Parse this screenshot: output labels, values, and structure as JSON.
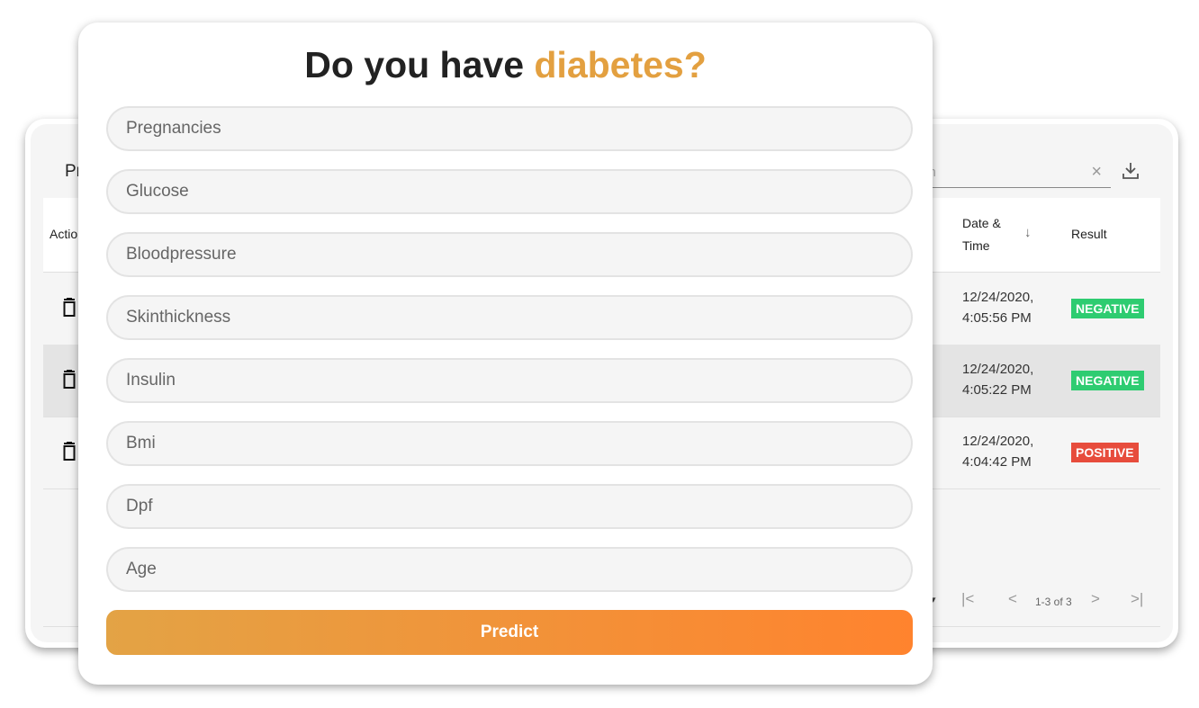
{
  "table": {
    "title": "Pr",
    "search_placeholder": "ch",
    "clear_symbol": "×",
    "columns": {
      "actions": "Actio",
      "date_time": "Date & Time",
      "result": "Result"
    },
    "sort_symbol": "↓",
    "rows": [
      {
        "date": "12/24/2020,",
        "time": "4:05:56 PM",
        "result": "NEGATIVE",
        "result_color": "#2ecc71"
      },
      {
        "date": "12/24/2020,",
        "time": "4:05:22 PM",
        "result": "NEGATIVE",
        "result_color": "#2ecc71"
      },
      {
        "date": "12/24/2020,",
        "time": "4:04:42 PM",
        "result": "POSITIVE",
        "result_color": "#e74c3c"
      }
    ],
    "pagination": {
      "dropdown_arrow": "▾",
      "first": "|<",
      "prev": "<",
      "range": "1-3 of 3",
      "next": ">",
      "last": ">|"
    }
  },
  "form": {
    "title_prefix": "Do you have ",
    "title_accent": "diabetes?",
    "accent_color": "#e3a040",
    "fields": [
      {
        "placeholder": "Pregnancies",
        "value": ""
      },
      {
        "placeholder": "Glucose",
        "value": ""
      },
      {
        "placeholder": "Bloodpressure",
        "value": ""
      },
      {
        "placeholder": "Skinthickness",
        "value": ""
      },
      {
        "placeholder": "Insulin",
        "value": ""
      },
      {
        "placeholder": "Bmi",
        "value": ""
      },
      {
        "placeholder": "Dpf",
        "value": ""
      },
      {
        "placeholder": "Age",
        "value": ""
      }
    ],
    "submit_label": "Predict"
  }
}
